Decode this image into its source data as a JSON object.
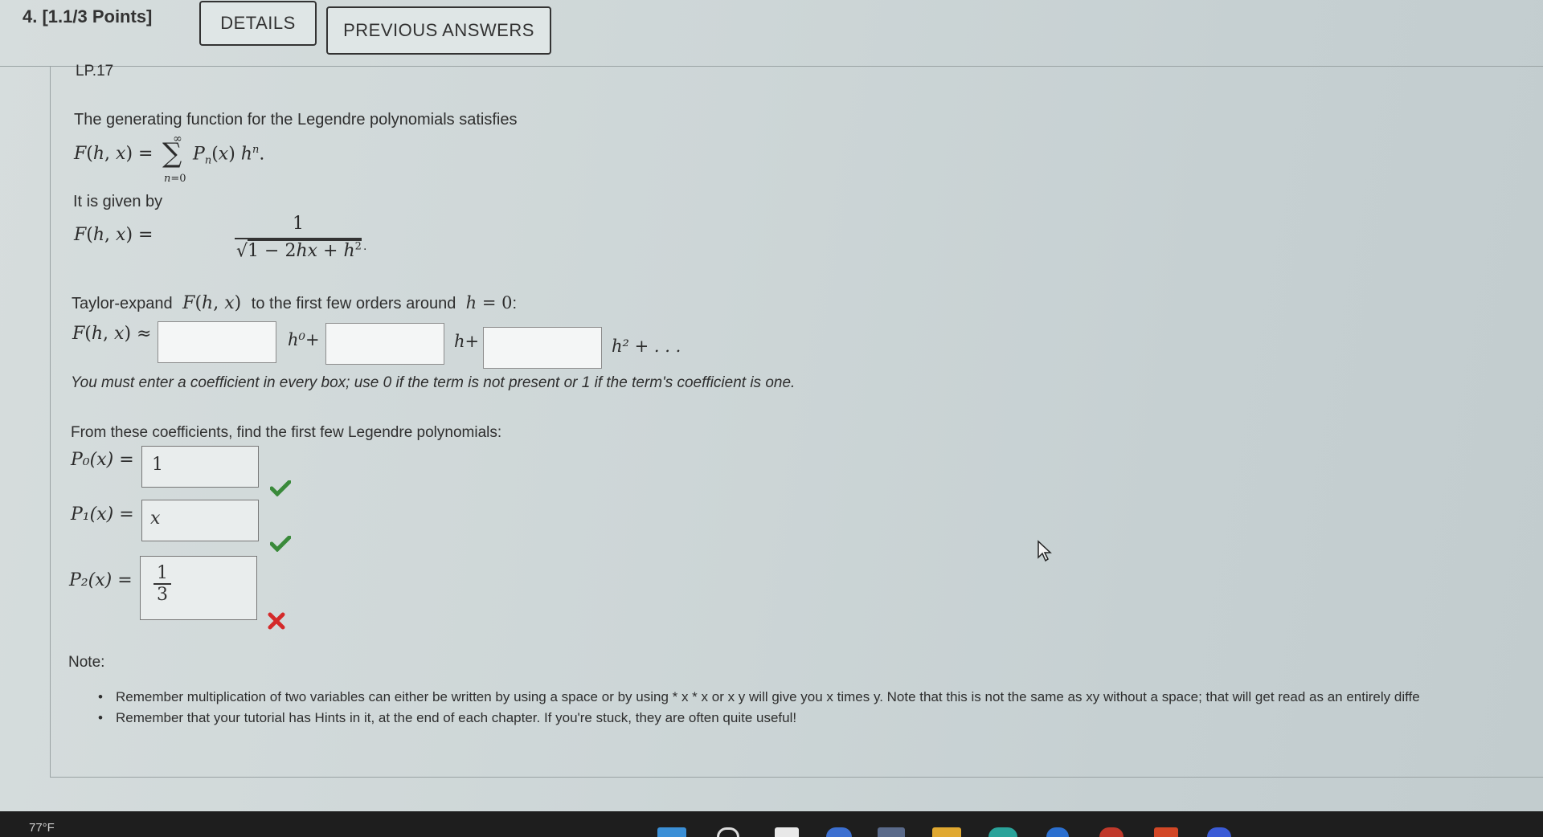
{
  "header": {
    "question_label": "4. [1.1/3 Points]",
    "details_button": "DETAILS",
    "previous_answers_button": "PREVIOUS ANSWERS"
  },
  "problem": {
    "id": "LP.17",
    "intro": "The generating function for the Legendre polynomials satisfies",
    "given_by": "It is given by",
    "taylor_prefix": "Taylor-expand",
    "taylor_middle": "to the first few orders around",
    "instruction": "You must enter a coefficient in every box; use 0 if the term is not present or 1 if the term's coefficient is one.",
    "find_prompt": "From these coefficients, find the first few Legendre polynomials:"
  },
  "expansion_inputs": [
    {
      "value": "",
      "suffix": "h⁰+"
    },
    {
      "value": "",
      "suffix": "h+"
    },
    {
      "value": "",
      "suffix": "h² + . . ."
    }
  ],
  "answers": [
    {
      "label": "P₀(x) =",
      "value": "1",
      "status": "correct"
    },
    {
      "label": "P₁(x) =",
      "value": "x",
      "status": "correct"
    },
    {
      "label": "P₂(x) =",
      "numerator": "1",
      "denominator": "3",
      "status": "incorrect"
    }
  ],
  "note": {
    "title": "Note:",
    "items": [
      "Remember multiplication of two variables can either be written by using a space or by using * x * x or x y will give you x times y. Note that this is not the same as xy without a space; that will get read as an entirely diffe",
      "Remember that your tutorial has Hints in it, at the end of each chapter. If you're stuck, they are often quite useful!"
    ]
  },
  "taskbar": {
    "temperature": "77°F"
  },
  "colors": {
    "correct": "#3a8a3a",
    "incorrect": "#d42a2a",
    "taskbar": "#1e1e1e"
  }
}
